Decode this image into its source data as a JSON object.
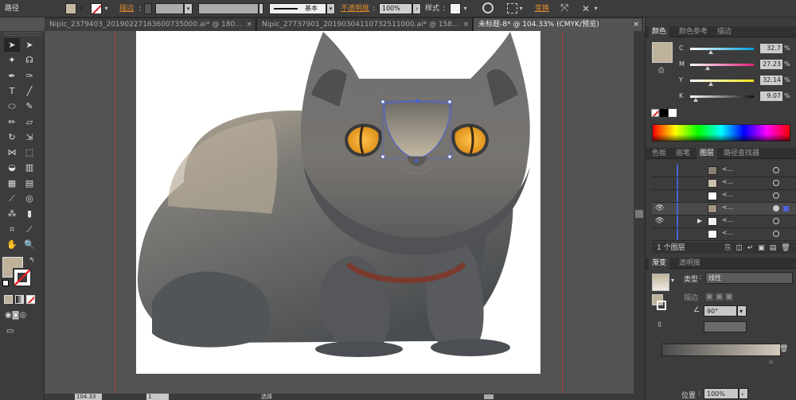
{
  "control_bar": {
    "object_type": "路径",
    "stroke_label": "描边",
    "stroke_profile_label": "基本",
    "opacity_label": "不透明度",
    "opacity_value": "100%",
    "style_label": "样式",
    "transform_label": "变换",
    "accent_color": "#e08a2a"
  },
  "document_tabs": [
    {
      "title": "Nipic_2379403_20190227163600735000.ai* @ 180...",
      "close": "×",
      "active": false
    },
    {
      "title": "Nipic_27737901_20190304110732511000.ai* @ 158...",
      "close": "×",
      "active": false
    },
    {
      "title": "未标题-8* @ 104.33% (CMYK/预览)",
      "close": "×",
      "active": true
    }
  ],
  "tools": [
    {
      "icon": "selection-icon",
      "glyph": "➤",
      "active": true
    },
    {
      "icon": "direct-selection-icon",
      "glyph": "➤"
    },
    {
      "icon": "magic-wand-icon",
      "glyph": "✦"
    },
    {
      "icon": "lasso-icon",
      "glyph": "☊"
    },
    {
      "icon": "pen-icon",
      "glyph": "✒"
    },
    {
      "icon": "curvature-icon",
      "glyph": "✑"
    },
    {
      "icon": "type-icon",
      "glyph": "T"
    },
    {
      "icon": "line-icon",
      "glyph": "╱"
    },
    {
      "icon": "ellipse-icon",
      "glyph": "⬭"
    },
    {
      "icon": "paintbrush-icon",
      "glyph": "✎"
    },
    {
      "icon": "pencil-icon",
      "glyph": "✏"
    },
    {
      "icon": "eraser-icon",
      "glyph": "▱"
    },
    {
      "icon": "rotate-icon",
      "glyph": "↻"
    },
    {
      "icon": "scale-icon",
      "glyph": "⇲"
    },
    {
      "icon": "width-icon",
      "glyph": "⋈"
    },
    {
      "icon": "free-transform-icon",
      "glyph": "⬚"
    },
    {
      "icon": "shape-builder-icon",
      "glyph": "◒"
    },
    {
      "icon": "perspective-grid-icon",
      "glyph": "▥"
    },
    {
      "icon": "mesh-icon",
      "glyph": "▦"
    },
    {
      "icon": "gradient-icon",
      "glyph": "▤"
    },
    {
      "icon": "eyedropper-icon",
      "glyph": "⟋"
    },
    {
      "icon": "blend-icon",
      "glyph": "◎"
    },
    {
      "icon": "symbol-sprayer-icon",
      "glyph": "⁂"
    },
    {
      "icon": "column-graph-icon",
      "glyph": "▮"
    },
    {
      "icon": "artboard-icon",
      "glyph": "⌗"
    },
    {
      "icon": "slice-icon",
      "glyph": "⟋"
    },
    {
      "icon": "hand-icon",
      "glyph": "✋"
    },
    {
      "icon": "zoom-icon",
      "glyph": "🔍"
    }
  ],
  "fill_color": "#bfb29a",
  "color_panel": {
    "tabs": [
      "颜色",
      "颜色参考",
      "描边"
    ],
    "rows": [
      {
        "label": "C",
        "value": "32.7",
        "unit": "%",
        "level": 0.327,
        "bar": [
          "#ffffff",
          "#00a0e0"
        ]
      },
      {
        "label": "M",
        "value": "27.23",
        "unit": "%",
        "level": 0.2723,
        "bar": [
          "#ffffff",
          "#e0207a"
        ]
      },
      {
        "label": "Y",
        "value": "32.14",
        "unit": "%",
        "level": 0.3214,
        "bar": [
          "#ffffff",
          "#f2e21a"
        ]
      },
      {
        "label": "K",
        "value": "9.07",
        "unit": "%",
        "level": 0.0907,
        "bar": [
          "#ffffff",
          "#111111"
        ]
      }
    ]
  },
  "layers_panel": {
    "tabs": [
      "色板",
      "画笔",
      "图层",
      "路径查找器"
    ],
    "rows": [
      {
        "name": "<...",
        "visible": false,
        "arrow": "",
        "thumb": "#8a7f70",
        "selected": false
      },
      {
        "name": "<...",
        "visible": false,
        "arrow": "",
        "thumb": "#c9bfae",
        "selected": false
      },
      {
        "name": "<...",
        "visible": false,
        "arrow": "",
        "thumb": "#ffffff",
        "selected": false
      },
      {
        "name": "<...",
        "visible": true,
        "arrow": "",
        "thumb": "#a09585",
        "selected": true
      },
      {
        "name": "<...",
        "visible": true,
        "arrow": "▶",
        "thumb": "#f2f2f2",
        "selected": false
      },
      {
        "name": "<...",
        "visible": false,
        "arrow": "",
        "thumb": "#ffffff",
        "selected": false
      }
    ],
    "footer": "1 个图层"
  },
  "gradient_panel": {
    "tabs": [
      "渐变",
      "透明度"
    ],
    "type_label": "类型",
    "type_value": "线性",
    "stroke_label": "描边",
    "angle_value": "90°",
    "position_label": "位置",
    "position_value": "100%"
  },
  "status_bar": {
    "zoom": "104.33",
    "page": "1",
    "tool_name": "选择"
  },
  "colors": {
    "accent": "#e08a2a",
    "cat_body": "#5c5c5c",
    "eye": "#f0a830"
  }
}
